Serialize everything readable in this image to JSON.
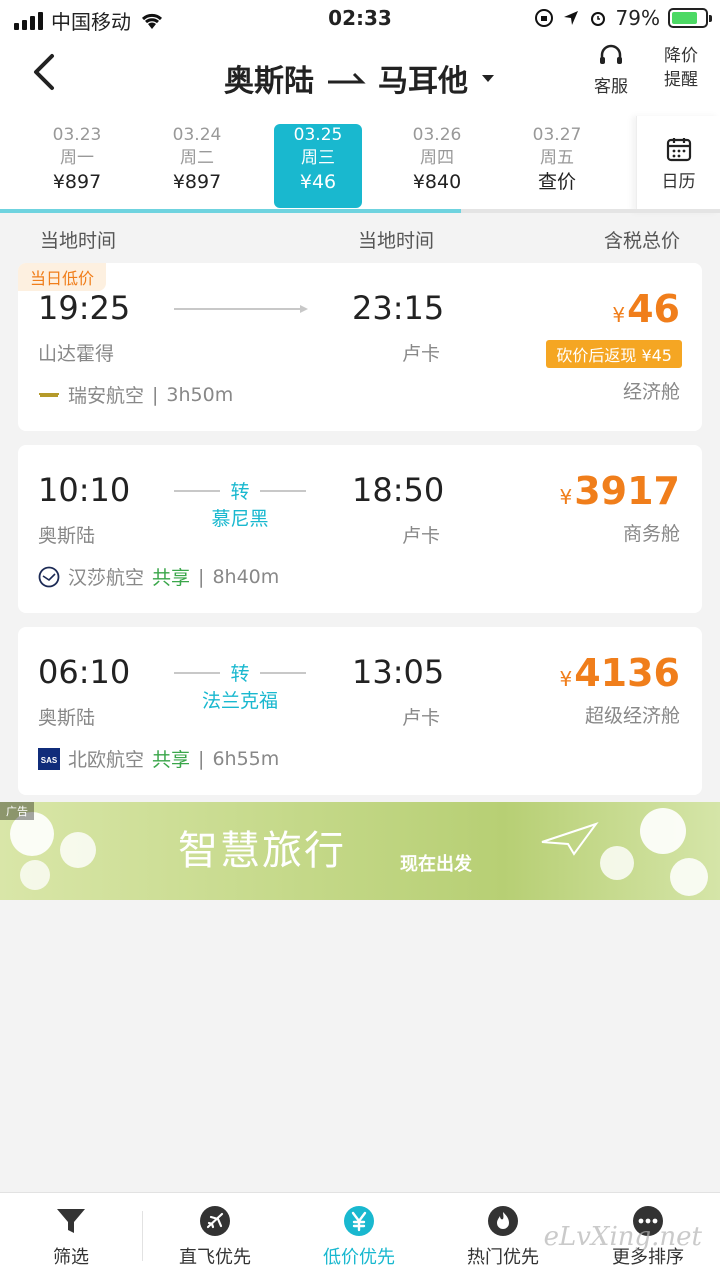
{
  "status": {
    "carrier": "中国移动",
    "time": "02:33",
    "battery": "79%"
  },
  "header": {
    "from": "奥斯陆",
    "to": "马耳他",
    "service_label": "客服",
    "alert_label_1": "降价",
    "alert_label_2": "提醒"
  },
  "dates": [
    {
      "date": "03.23",
      "weekday": "周一",
      "price": "¥897"
    },
    {
      "date": "03.24",
      "weekday": "周二",
      "price": "¥897"
    },
    {
      "date": "03.25",
      "weekday": "周三",
      "price": "¥46"
    },
    {
      "date": "03.26",
      "weekday": "周四",
      "price": "¥840"
    },
    {
      "date": "03.27",
      "weekday": "周五",
      "price": "查价"
    }
  ],
  "calendar_label": "日历",
  "columns": {
    "dep": "当地时间",
    "arr": "当地时间",
    "price": "含税总价"
  },
  "flights": [
    {
      "tag": "当日低价",
      "dep_time": "19:25",
      "dep_airport": "山达霍得",
      "arr_time": "23:15",
      "arr_airport": "卢卡",
      "price": "46",
      "rebate": "砍价后返现 ¥45",
      "cabin": "经济舱",
      "airline": "瑞安航空",
      "duration": "3h50m"
    },
    {
      "dep_time": "10:10",
      "dep_airport": "奥斯陆",
      "transfer": "转",
      "via": "慕尼黑",
      "arr_time": "18:50",
      "arr_airport": "卢卡",
      "price": "3917",
      "cabin": "商务舱",
      "airline": "汉莎航空",
      "shared": "共享",
      "duration": "8h40m"
    },
    {
      "dep_time": "06:10",
      "dep_airport": "奥斯陆",
      "transfer": "转",
      "via": "法兰克福",
      "arr_time": "13:05",
      "arr_airport": "卢卡",
      "price": "4136",
      "cabin": "超级经济舱",
      "airline": "北欧航空",
      "shared": "共享",
      "duration": "6h55m"
    }
  ],
  "currency": "¥",
  "separator": "|",
  "ad": {
    "tag": "广告",
    "title": "智慧旅行",
    "sub": "现在出发"
  },
  "nav": [
    {
      "label": "筛选",
      "icon": "filter-icon"
    },
    {
      "label": "直飞优先",
      "icon": "plane-icon"
    },
    {
      "label": "低价优先",
      "icon": "yen-icon"
    },
    {
      "label": "热门优先",
      "icon": "fire-icon"
    },
    {
      "label": "更多排序",
      "icon": "more-icon"
    }
  ],
  "watermark": "eLvXing.net",
  "colors": {
    "accent": "#19b8cf",
    "price": "#f07e1b",
    "shared": "#3aa64a"
  }
}
